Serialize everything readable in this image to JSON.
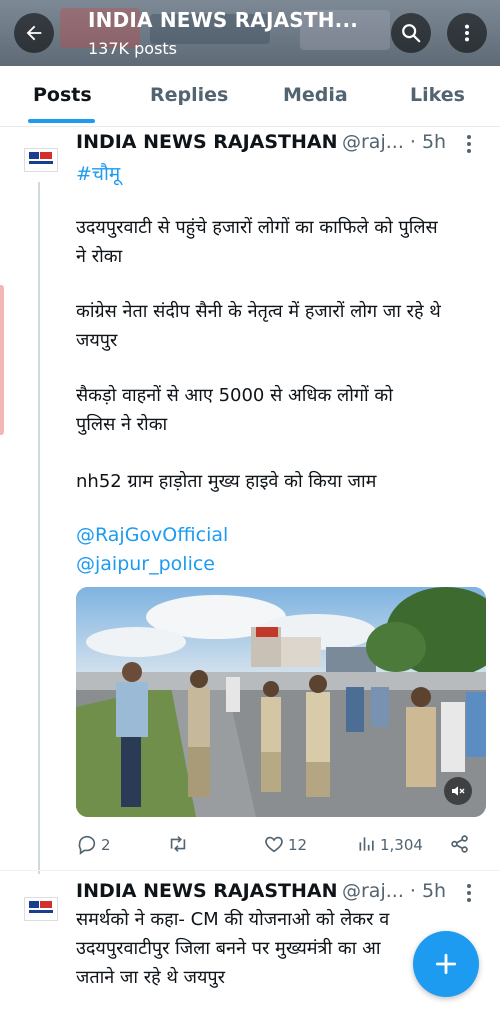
{
  "header": {
    "title": "INDIA NEWS RAJASTH...",
    "subtitle": "137K posts"
  },
  "tabs": [
    {
      "label": "Posts",
      "active": true
    },
    {
      "label": "Replies",
      "active": false
    },
    {
      "label": "Media",
      "active": false
    },
    {
      "label": "Likes",
      "active": false
    }
  ],
  "post1": {
    "author": "INDIA NEWS RAJASTHAN",
    "meta": "@raj... · 5h",
    "hashtag": "#चौमू",
    "p1_l1": "उदयपुरवाटी से पहुंचे हजारों लोगों का काफिले को पुलिस",
    "p1_l2": "ने रोका",
    "p2_l1": "कांग्रेस नेता संदीप सैनी  के नेतृत्व में हजारों लोग जा रहे थे",
    "p2_l2": "जयपुर",
    "p3_l1": "सैकड़ो वाहनों से आए 5000 से अधिक लोगों को",
    "p3_l2": "पुलिस ने रोका",
    "p4": "nh52 ग्राम हाड़ोता मुख्य हाइवे को किया जाम",
    "mention1": "@RajGovOfficial",
    "mention2": "@jaipur_police",
    "actions": {
      "replies": "2",
      "reposts": "",
      "likes": "12",
      "views": "1,304"
    }
  },
  "post2": {
    "author": "INDIA NEWS RAJASTHAN",
    "meta": "@raj... · 5h",
    "l1": "समर्थको ने कहा- CM की योजनाओ को लेकर व",
    "l2": "उदयपुरवाटीपुर जिला बनने पर मुख्यमंत्री का आ",
    "l3": "जताने जा रहे थे जयपुर"
  },
  "icons": {
    "back": "back-arrow-icon",
    "search": "search-icon",
    "more": "more-vertical-icon",
    "reply": "reply-icon",
    "repost": "repost-icon",
    "like": "heart-icon",
    "views": "views-icon",
    "share": "share-icon",
    "mute": "mute-icon",
    "compose": "plus-icon"
  },
  "colors": {
    "accent": "#1d9bf0",
    "text": "#0f1419",
    "muted": "#536471"
  }
}
